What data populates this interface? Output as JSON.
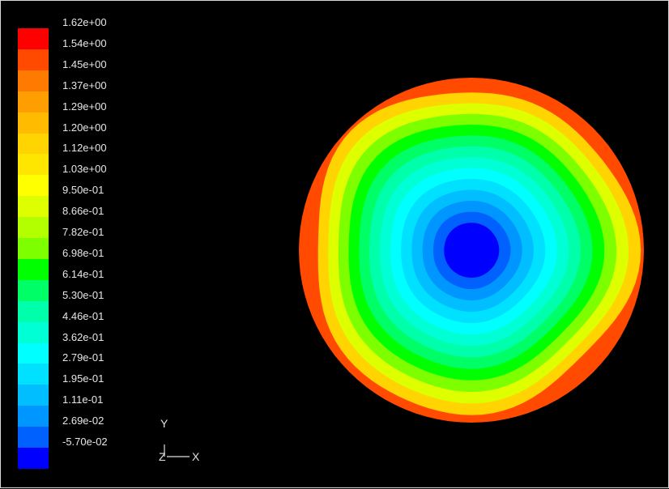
{
  "chart_data": {
    "type": "heatmap",
    "title": "",
    "colorbar": {
      "labels": [
        "1.62e+00",
        "1.54e+00",
        "1.45e+00",
        "1.37e+00",
        "1.29e+00",
        "1.20e+00",
        "1.12e+00",
        "1.03e+00",
        "9.50e-01",
        "8.66e-01",
        "7.82e-01",
        "6.98e-01",
        "6.14e-01",
        "5.30e-01",
        "4.46e-01",
        "3.62e-01",
        "2.79e-01",
        "1.95e-01",
        "1.11e-01",
        "2.69e-02",
        "-5.70e-02"
      ],
      "values": [
        1.62,
        1.54,
        1.45,
        1.37,
        1.29,
        1.2,
        1.12,
        1.03,
        0.95,
        0.866,
        0.782,
        0.698,
        0.614,
        0.53,
        0.446,
        0.362,
        0.279,
        0.195,
        0.111,
        0.0269,
        -0.057
      ],
      "colors": [
        "#ff0000",
        "#ff4a00",
        "#ff7a00",
        "#ff9e00",
        "#ffbb00",
        "#ffd400",
        "#ffe600",
        "#ffff00",
        "#ddff00",
        "#b3ff00",
        "#7dff00",
        "#00ff00",
        "#00ff66",
        "#00ffaa",
        "#00ffd5",
        "#00ffff",
        "#00e1ff",
        "#00beff",
        "#0096ff",
        "#0061ff",
        "#0000ff"
      ]
    },
    "triad": {
      "y_label": "Y",
      "z_label": "Z",
      "x_label": "X"
    },
    "contour_levels": [
      {
        "color": "#ff4a00",
        "value": 1.54
      },
      {
        "color": "#ffd400",
        "value": 1.2
      },
      {
        "color": "#ddff00",
        "value": 0.95
      },
      {
        "color": "#7dff00",
        "value": 0.782
      },
      {
        "color": "#00ff00",
        "value": 0.698
      },
      {
        "color": "#00ff66",
        "value": 0.614
      },
      {
        "color": "#00ffaa",
        "value": 0.53
      },
      {
        "color": "#00ffd5",
        "value": 0.446
      },
      {
        "color": "#00ffff",
        "value": 0.362
      },
      {
        "color": "#00e1ff",
        "value": 0.279
      },
      {
        "color": "#00beff",
        "value": 0.195
      },
      {
        "color": "#0096ff",
        "value": 0.111
      },
      {
        "color": "#0061ff",
        "value": 0.0269
      },
      {
        "color": "#0000ff",
        "value": -0.057
      }
    ]
  }
}
